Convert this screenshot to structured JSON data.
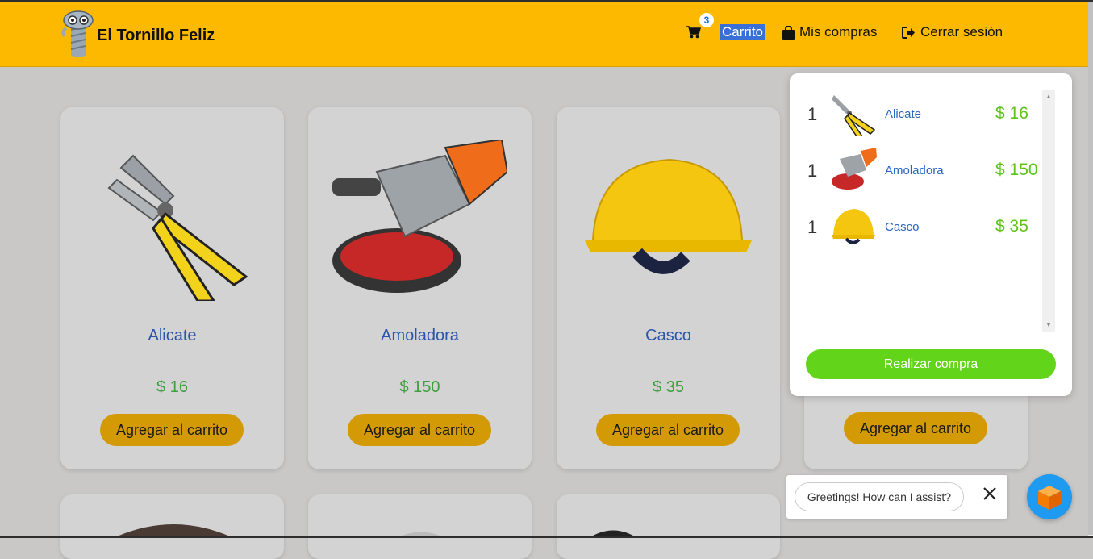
{
  "header": {
    "brand": "El Tornillo Feliz",
    "nav": {
      "cart_count": "3",
      "cart_label": "Carrito",
      "purchases_label": "Mis compras",
      "logout_label": "Cerrar sesión"
    }
  },
  "products": [
    {
      "name": "Alicate",
      "price": "$ 16",
      "button": "Agregar al carrito",
      "icon": "pliers"
    },
    {
      "name": "Amoladora",
      "price": "$ 150",
      "button": "Agregar al carrito",
      "icon": "angle-grinder"
    },
    {
      "name": "Casco",
      "price": "$ 35",
      "button": "Agregar al carrito",
      "icon": "hard-hat"
    },
    {
      "name": "",
      "price": "",
      "button": "Agregar al carrito",
      "icon": ""
    }
  ],
  "cart_dropdown": {
    "items": [
      {
        "qty": "1",
        "name": "Alicate",
        "price": "$ 16",
        "icon": "pliers"
      },
      {
        "qty": "1",
        "name": "Amoladora",
        "price": "$ 150",
        "icon": "angle-grinder"
      },
      {
        "qty": "1",
        "name": "Casco",
        "price": "$ 35",
        "icon": "hard-hat"
      }
    ],
    "checkout_label": "Realizar compra"
  },
  "chat": {
    "greeting": "Greetings! How can I assist?",
    "close_icon": "close-icon",
    "fab_icon": "cube-icon"
  },
  "colors": {
    "header_bg": "#fdb900",
    "add_button": "#d39a05",
    "checkout_button": "#62d41a",
    "price_green": "#3c9f3c",
    "product_name_blue": "#2a55a8"
  }
}
